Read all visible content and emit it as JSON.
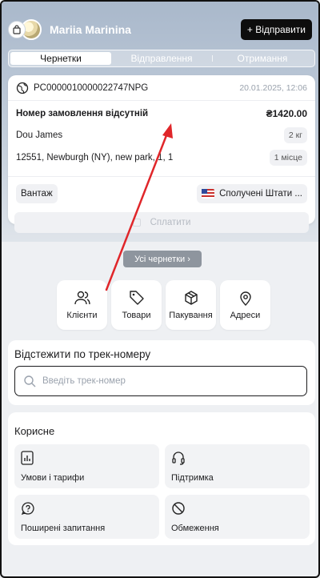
{
  "header": {
    "username": "Mariia Marinina",
    "send_button": "+ Відправити"
  },
  "tabs": [
    {
      "label": "Чернетки",
      "active": true
    },
    {
      "label": "Відправлення",
      "active": false
    },
    {
      "label": "Отримання",
      "active": false
    }
  ],
  "draft": {
    "id": "PC0000010000022747NPG",
    "date": "20.01.2025, 12:06",
    "order_title": "Номер замовлення відсутній",
    "amount": "₴1420.00",
    "recipient": "Dou James",
    "weight": "2 кг",
    "address": "12551, Newburgh (NY), new park, 1, 1",
    "places": "1 місце",
    "cargo_type": "Вантаж",
    "country": "Сполучені Штати ...",
    "pay_button": "Сплатити"
  },
  "all_drafts_button": "Усі чернетки ›",
  "quick_actions": [
    {
      "label": "Клієнти",
      "icon": "users-icon"
    },
    {
      "label": "Товари",
      "icon": "tag-icon"
    },
    {
      "label": "Пакування",
      "icon": "box-icon"
    },
    {
      "label": "Адреси",
      "icon": "map-pin-icon"
    }
  ],
  "tracking": {
    "title": "Відстежити по трек-номеру",
    "placeholder": "Введіть трек-номер"
  },
  "useful": {
    "title": "Корисне",
    "items": [
      {
        "label": "Умови і тарифи",
        "icon": "chart-icon"
      },
      {
        "label": "Підтримка",
        "icon": "headset-icon"
      },
      {
        "label": "Поширені запитання",
        "icon": "question-icon"
      },
      {
        "label": "Обмеження",
        "icon": "restriction-icon"
      }
    ]
  },
  "colors": {
    "header_gradient_top": "#a9b8cb",
    "send_button_bg": "#0d0d0d",
    "annotation_arrow": "#e0262a"
  }
}
